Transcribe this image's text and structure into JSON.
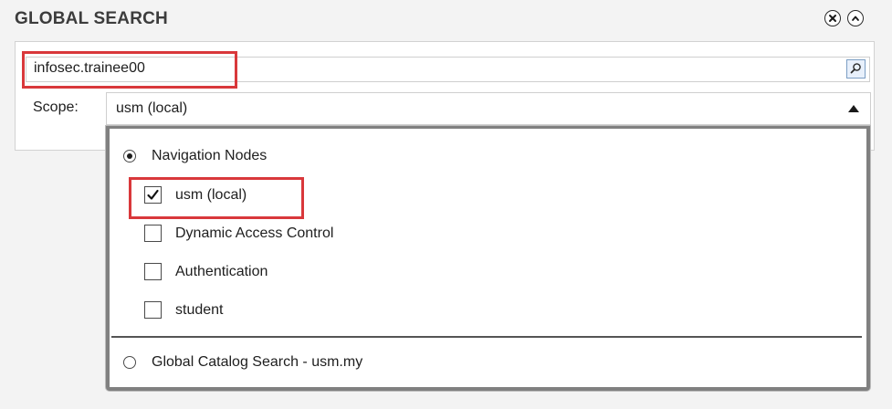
{
  "panel": {
    "title": "GLOBAL SEARCH",
    "close_icon": "close-circle-icon",
    "collapse_icon": "collapse-up-circle-icon"
  },
  "search": {
    "value": "infosec.trainee00",
    "search_icon": "magnifier-icon"
  },
  "scope": {
    "label": "Scope:",
    "selected": "usm (local)"
  },
  "dropdown": {
    "navigation_option": {
      "label": "Navigation Nodes",
      "selected": true
    },
    "nodes": [
      {
        "label": "usm (local)",
        "checked": true
      },
      {
        "label": "Dynamic Access Control",
        "checked": false
      },
      {
        "label": "Authentication",
        "checked": false
      },
      {
        "label": "student",
        "checked": false
      }
    ],
    "global_catalog_option": {
      "label": "Global Catalog Search - usm.my",
      "selected": false
    }
  },
  "colors": {
    "highlight": "#d9383b",
    "dropdown_border": "#808080"
  }
}
